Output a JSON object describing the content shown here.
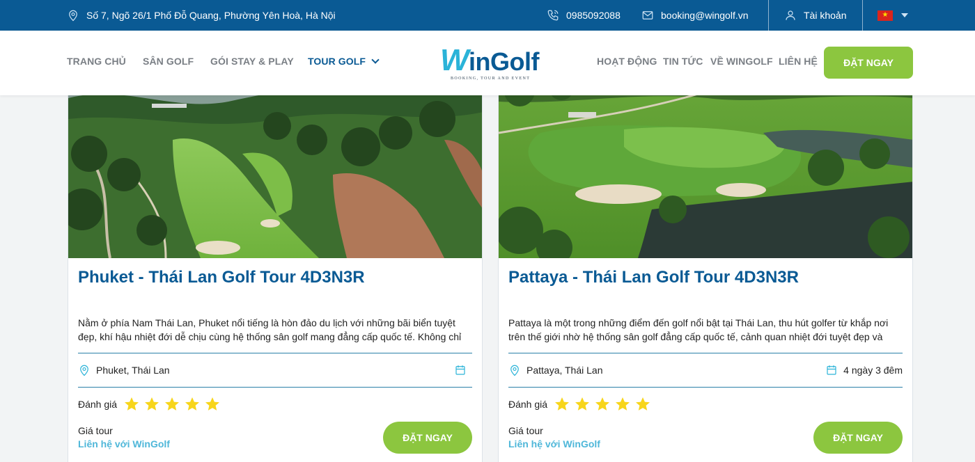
{
  "topbar": {
    "address": "Số 7, Ngõ 26/1 Phố Đỗ Quang, Phường Yên Hoà, Hà Nội",
    "phone": "0985092088",
    "email": "booking@wingolf.vn",
    "account": "Tài khoản",
    "flag_star": "★",
    "icons": [
      "map-pin-icon",
      "phone-icon",
      "mail-icon",
      "user-icon",
      "vietnam-flag-icon",
      "caret-down-icon"
    ]
  },
  "nav": {
    "left": [
      "TRANG CHỦ",
      "SÂN GOLF",
      "GÓI STAY & PLAY",
      "TOUR GOLF"
    ],
    "right": [
      "HOẠT ĐỘNG",
      "TIN TỨC",
      "VỀ WINGOLF",
      "LIÊN HỆ"
    ],
    "active": "TOUR GOLF",
    "book_label": "ĐẶT NGAY",
    "logo": {
      "mark": "W",
      "text": "inGolf",
      "tagline": "BOOKING, TOUR AND EVENT"
    }
  },
  "colors": {
    "brand_blue": "#0a5a94",
    "accent_green": "#8cc63f",
    "accent_cyan": "#4fb7d9",
    "star": "#f7d51b"
  },
  "cards": [
    {
      "title": "Phuket - Thái Lan Golf Tour 4D3N3R",
      "description": "Nằm ở phía Nam Thái Lan, Phuket nổi tiếng là hòn đảo du lịch với những bãi biển tuyệt đẹp, khí hậu nhiệt đới dễ chịu cùng hệ thống sân golf mang đẳng cấp quốc tế. Không chỉ",
      "location": "Phuket, Thái Lan",
      "duration": "",
      "rating_label": "Đánh giá",
      "stars": 5,
      "price_label": "Giá tour",
      "price_value": "Liên hệ với WinGolf",
      "book_label": "ĐẶT NGAY"
    },
    {
      "title": "Pattaya - Thái Lan Golf Tour 4D3N3R",
      "description": "Pattaya là một trong những điểm đến golf nổi bật tại Thái Lan, thu hút golfer từ khắp nơi trên thế giới nhờ hệ thống sân golf đẳng cấp quốc tế, cảnh quan nhiệt đới tuyệt đẹp và",
      "location": "Pattaya, Thái Lan",
      "duration": "4 ngày 3 đêm",
      "rating_label": "Đánh giá",
      "stars": 5,
      "price_label": "Giá tour",
      "price_value": "Liên hệ với WinGolf",
      "book_label": "ĐẶT NGAY"
    }
  ]
}
